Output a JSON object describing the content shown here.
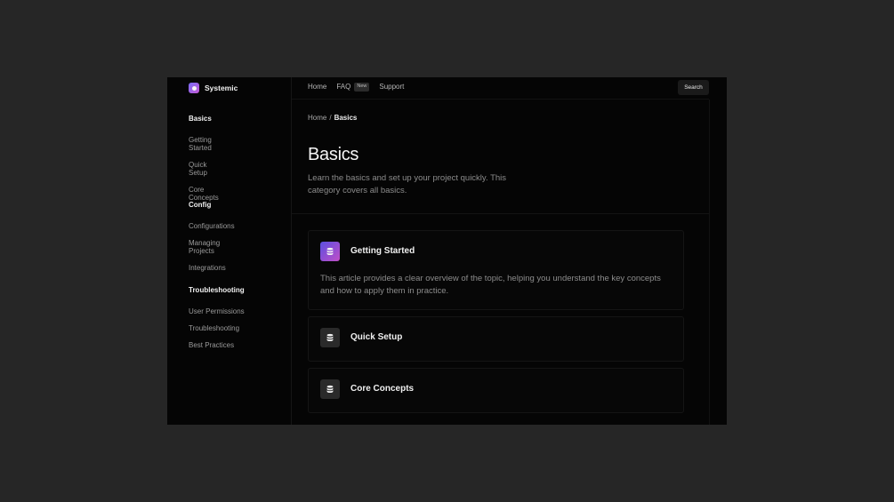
{
  "brand": {
    "name": "Systemic",
    "logo_icon": "systemic-logo-icon"
  },
  "sidebar": {
    "groups": [
      {
        "title": "Basics",
        "items": [
          "Getting Started",
          "Quick Setup",
          "Core Concepts"
        ]
      },
      {
        "title": "Config",
        "items": [
          "Configurations",
          "Managing Projects",
          "Integrations"
        ]
      },
      {
        "title": "Troubleshooting",
        "items": [
          "User Permissions",
          "Troubleshooting",
          "Best Practices"
        ]
      }
    ]
  },
  "topnav": {
    "home": "Home",
    "faq": "FAQ",
    "faq_badge": "New",
    "support": "Support",
    "search": "Search"
  },
  "breadcrumb": {
    "root": "Home",
    "separator": "/",
    "current": "Basics"
  },
  "page": {
    "title": "Basics",
    "description": "Learn the basics and set up your project quickly. This category covers all basics."
  },
  "cards": [
    {
      "title": "Getting Started",
      "description": "This article provides a clear overview of the topic, helping you understand the key concepts and how to apply them in practice.",
      "icon": "database-icon"
    },
    {
      "title": "Quick Setup",
      "icon": "database-icon"
    },
    {
      "title": "Core Concepts",
      "icon": "database-icon"
    }
  ],
  "colors": {
    "background": "#262626",
    "panel": "#050505",
    "accent_from": "#5b4fe0",
    "accent_to": "#c14fc7"
  }
}
